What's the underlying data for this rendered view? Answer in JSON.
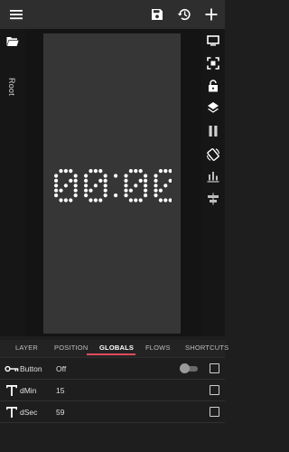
{
  "clock": {
    "text": "00:00"
  },
  "tree": {
    "root_label": "Root"
  },
  "tabs": [
    {
      "label": "LAYER"
    },
    {
      "label": "POSITION"
    },
    {
      "label": "GLOBALS",
      "active": true
    },
    {
      "label": "FLOWS"
    },
    {
      "label": "SHORTCUTS"
    }
  ],
  "globals": [
    {
      "icon": "toggle-key-icon",
      "name": "Button",
      "value": "Off",
      "toggle": "off"
    },
    {
      "icon": "text-t-icon",
      "name": "dMin",
      "value": "15"
    },
    {
      "icon": "text-t-icon",
      "name": "dSec",
      "value": "59"
    }
  ],
  "colors": {
    "accent": "#e04b5f",
    "screen_bg": "#363636",
    "topbar": "#2e2e2e"
  }
}
